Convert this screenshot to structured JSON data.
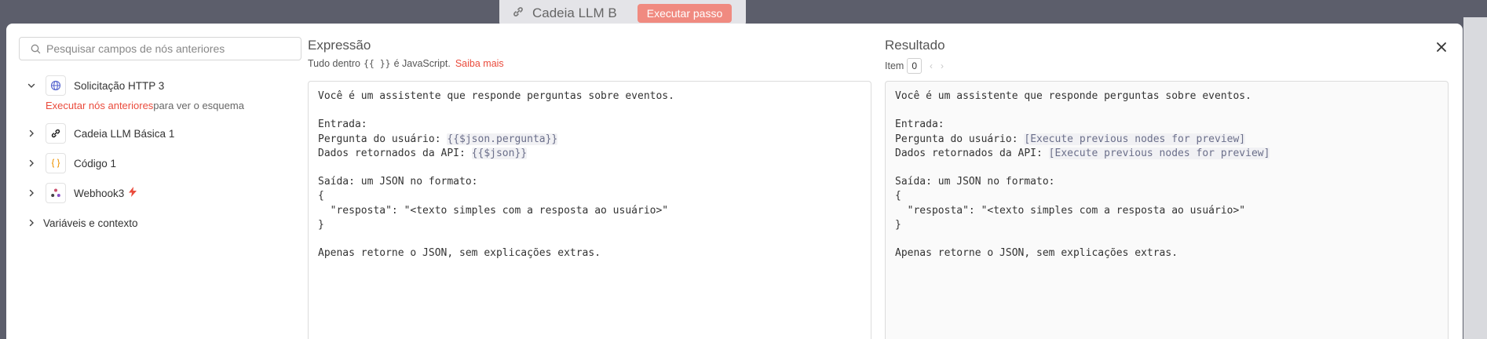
{
  "background": {
    "node_card_title": "Cadeia LLM B",
    "node_card_button": "Executar passo"
  },
  "search": {
    "placeholder": "Pesquisar campos de nós anteriores"
  },
  "tree": {
    "nodes": [
      {
        "label": "Solicitação HTTP 3",
        "icon": "globe-icon",
        "expanded": true
      },
      {
        "label": "Cadeia LLM Básica 1",
        "icon": "link-icon",
        "expanded": false
      },
      {
        "label": "Código 1",
        "icon": "braces-icon",
        "expanded": false
      },
      {
        "label": "Webhook3",
        "icon": "webhook-icon",
        "expanded": false
      }
    ],
    "hint_link": "Executar nós anteriores",
    "hint_text": "para ver o esquema",
    "vars_label": "Variáveis e contexto"
  },
  "expression": {
    "title": "Expressão",
    "sub_prefix": "Tudo dentro",
    "sub_code": "{{ }}",
    "sub_suffix": "é JavaScript.",
    "sub_link": "Saiba mais",
    "lines": {
      "l1": "Você é um assistente que responde perguntas sobre eventos.",
      "l3": "Entrada:",
      "l4_prefix": "Pergunta do usuário: ",
      "l4_expr": "{{$json.pergunta}}",
      "l5_prefix": "Dados retornados da API: ",
      "l5_expr": "{{$json}}",
      "l7": "Saída: um JSON no formato:",
      "l8": "{",
      "l9": "  \"resposta\": \"<texto simples com a resposta ao usuário>\"",
      "l10": "}",
      "l12": "Apenas retorne o JSON, sem explicações extras."
    }
  },
  "result": {
    "title": "Resultado",
    "item_label": "Item",
    "item_value": "0",
    "lines": {
      "l1": "Você é um assistente que responde perguntas sobre eventos.",
      "l3": "Entrada:",
      "l4_prefix": "Pergunta do usuário: ",
      "l4_expr": "[Execute previous nodes for preview]",
      "l5_prefix": "Dados retornados da API: ",
      "l5_expr": "[Execute previous nodes for preview]",
      "l7": "Saída: um JSON no formato:",
      "l8": "{",
      "l9": "  \"resposta\": \"<texto simples com a resposta ao usuário>\"",
      "l10": "}",
      "l12": "Apenas retorne o JSON, sem explicações extras."
    }
  },
  "colors": {
    "accent": "#ea4b3c",
    "expr_bg": "#f1f1f4"
  }
}
